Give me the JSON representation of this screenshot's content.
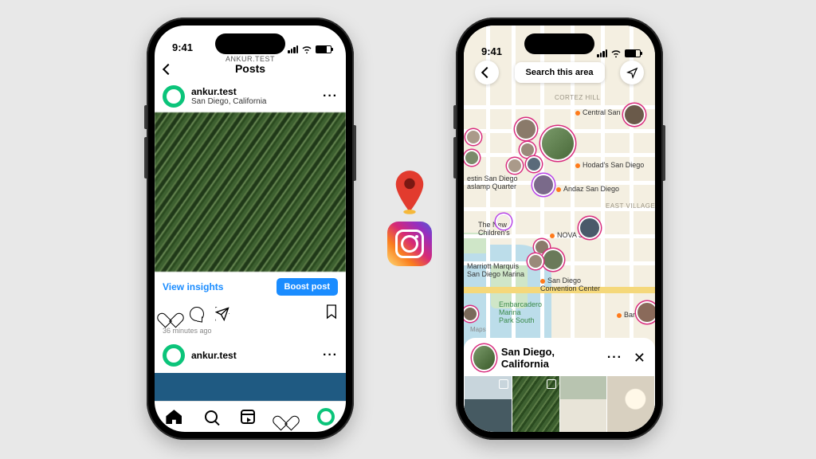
{
  "status": {
    "time": "9:41"
  },
  "left": {
    "header_sub": "ANKUR.TEST",
    "header_title": "Posts",
    "post": {
      "username": "ankur.test",
      "location": "San Diego, California",
      "view_insights": "View insights",
      "boost": "Boost post",
      "timestamp": "36 minutes ago"
    },
    "next_username": "ankur.test"
  },
  "right": {
    "search_button": "Search this area",
    "neighborhoods": {
      "cortez": "CORTEZ HILL",
      "eastvillage": "EAST VILLAGE"
    },
    "pois": {
      "central": "Central San Diego",
      "hodads": "Hodad's San Diego",
      "gaslamp": "estin San Diego\naslamp Quarter",
      "andaz": "Andaz San Diego",
      "childrens": "The New\nChildren's",
      "nova": "NOVA SD",
      "marriott": "Marriott Marquis\nSan Diego Marina",
      "convention": "San Diego\nConvention Center",
      "embarcadero": "Embarcadero\nMarina\nPark South",
      "barrio": "Barrio Loga"
    },
    "maps_attr": "Maps",
    "sheet_title": "San Diego, California"
  }
}
